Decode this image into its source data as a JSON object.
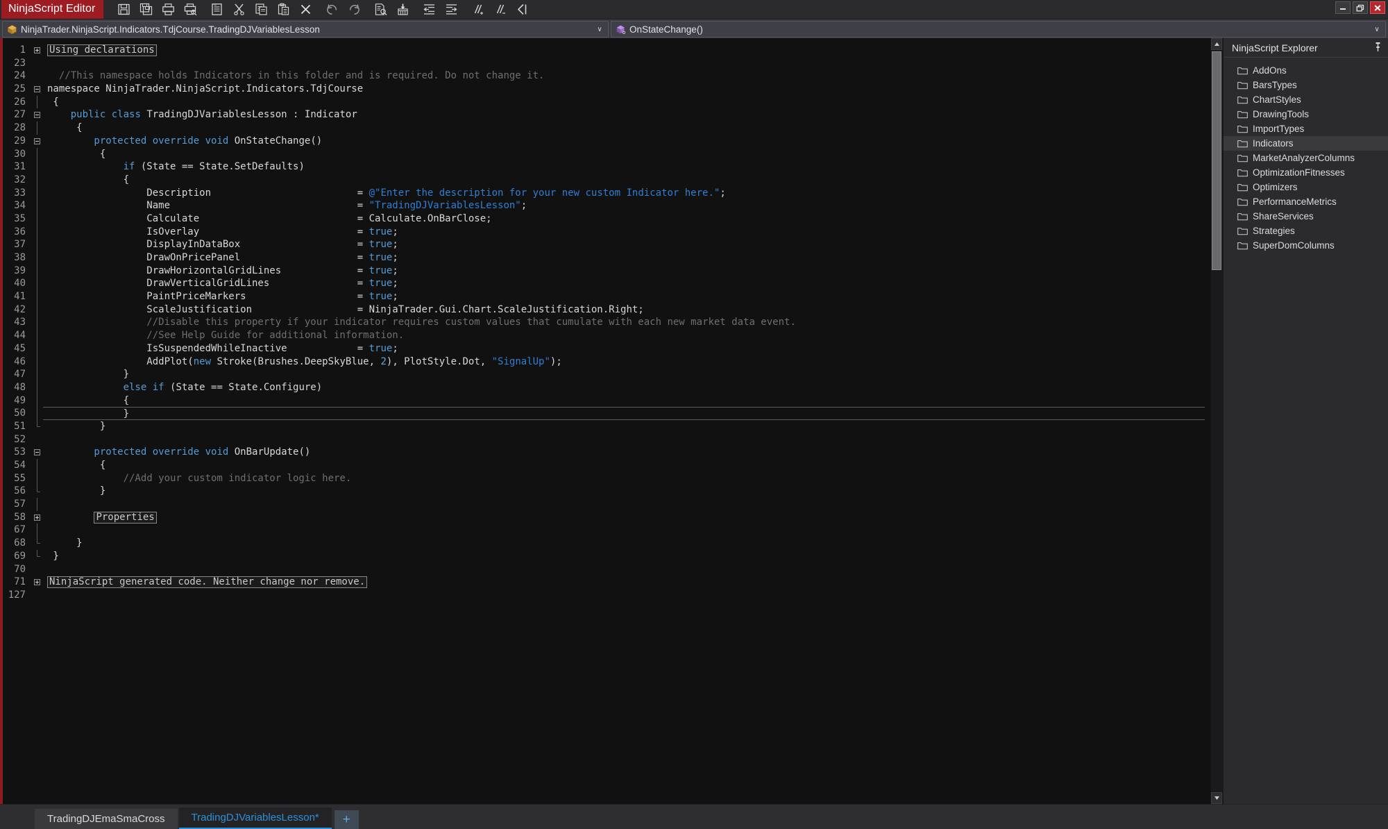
{
  "window": {
    "app_title": "NinjaScript Editor",
    "controls": {
      "minimize": "minimize-button",
      "restore": "restore-button",
      "close": "close-button"
    },
    "accent_red": "#9c1c22",
    "accent_blue": "#2f8fd6"
  },
  "toolbar": {
    "items": [
      {
        "name": "save-icon",
        "tip": "Save"
      },
      {
        "name": "save-all-icon",
        "tip": "Save All"
      },
      {
        "name": "print-icon",
        "tip": "Print"
      },
      {
        "name": "print-preview-icon",
        "tip": "Print Preview"
      },
      {
        "name": "new-file-icon",
        "tip": "New"
      },
      {
        "name": "cut-icon",
        "tip": "Cut"
      },
      {
        "name": "copy-icon",
        "tip": "Copy"
      },
      {
        "name": "paste-icon",
        "tip": "Paste"
      },
      {
        "name": "delete-icon",
        "tip": "Delete"
      },
      {
        "name": "undo-icon",
        "tip": "Undo"
      },
      {
        "name": "redo-icon",
        "tip": "Redo"
      },
      {
        "name": "find-icon",
        "tip": "Find"
      },
      {
        "name": "compile-icon",
        "tip": "Compile"
      },
      {
        "name": "outdent-icon",
        "tip": "Outdent"
      },
      {
        "name": "indent-icon",
        "tip": "Indent"
      },
      {
        "name": "comment-icon",
        "tip": "Comment"
      },
      {
        "name": "uncomment-icon",
        "tip": "Uncomment"
      },
      {
        "name": "collapse-icon",
        "tip": "Collapse"
      }
    ]
  },
  "navbar": {
    "class_selector": {
      "value": "NinjaTrader.NinjaScript.Indicators.TdjCourse.TradingDJVariablesLesson",
      "arrow": "∨"
    },
    "member_selector": {
      "value": "OnStateChange()",
      "arrow": "∨"
    }
  },
  "editor": {
    "line_numbers": [
      "1",
      "23",
      "24",
      "25",
      "26",
      "27",
      "28",
      "29",
      "30",
      "31",
      "32",
      "33",
      "34",
      "35",
      "36",
      "37",
      "38",
      "39",
      "40",
      "41",
      "42",
      "43",
      "44",
      "45",
      "46",
      "47",
      "48",
      "49",
      "50",
      "51",
      "52",
      "53",
      "54",
      "55",
      "56",
      "57",
      "58",
      "67",
      "68",
      "69",
      "70",
      "71",
      "127"
    ],
    "current_line": "50",
    "collapsed_regions": [
      {
        "line": "1",
        "label": "Using declarations"
      },
      {
        "line": "58",
        "label": "Properties"
      },
      {
        "line": "71",
        "label": "NinjaScript generated code. Neither change nor remove."
      }
    ],
    "code_lines": [
      {
        "n": "1",
        "fold": "plus",
        "segments": [
          {
            "t": "Using declarations",
            "c": "boxed"
          }
        ]
      },
      {
        "n": "23",
        "fold": "none",
        "segments": []
      },
      {
        "n": "24",
        "fold": "none",
        "segments": [
          {
            "t": "  //This namespace holds Indicators in this folder and is required. Do not change it.",
            "c": "cmt"
          }
        ]
      },
      {
        "n": "25",
        "fold": "minus",
        "segments": [
          {
            "t": "namespace NinjaTrader.NinjaScript.Indicators.TdjCourse",
            "c": "plain"
          }
        ]
      },
      {
        "n": "26",
        "fold": "bar",
        "segments": [
          {
            "t": " {",
            "c": "plain"
          }
        ]
      },
      {
        "n": "27",
        "fold": "minus",
        "segments": [
          {
            "t": "    public",
            "c": "kw"
          },
          {
            "t": " ",
            "c": "plain"
          },
          {
            "t": "class",
            "c": "kw"
          },
          {
            "t": " TradingDJVariablesLesson : Indicator",
            "c": "plain"
          }
        ]
      },
      {
        "n": "28",
        "fold": "bar",
        "segments": [
          {
            "t": "     {",
            "c": "plain"
          }
        ]
      },
      {
        "n": "29",
        "fold": "minus",
        "segments": [
          {
            "t": "        protected",
            "c": "kw"
          },
          {
            "t": " ",
            "c": "plain"
          },
          {
            "t": "override",
            "c": "kw"
          },
          {
            "t": " ",
            "c": "plain"
          },
          {
            "t": "void",
            "c": "kw"
          },
          {
            "t": " OnStateChange()",
            "c": "plain"
          }
        ]
      },
      {
        "n": "30",
        "fold": "bar",
        "segments": [
          {
            "t": "         {",
            "c": "plain"
          }
        ]
      },
      {
        "n": "31",
        "fold": "bar",
        "segments": [
          {
            "t": "             if",
            "c": "kw"
          },
          {
            "t": " (State == State.SetDefaults)",
            "c": "plain"
          }
        ]
      },
      {
        "n": "32",
        "fold": "bar",
        "segments": [
          {
            "t": "             {",
            "c": "plain"
          }
        ]
      },
      {
        "n": "33",
        "fold": "bar",
        "segments": [
          {
            "t": "                 Description                         = ",
            "c": "plain"
          },
          {
            "t": "@\"Enter the description for your new custom Indicator here.\"",
            "c": "str"
          },
          {
            "t": ";",
            "c": "plain"
          }
        ]
      },
      {
        "n": "34",
        "fold": "bar",
        "segments": [
          {
            "t": "                 Name                                = ",
            "c": "plain"
          },
          {
            "t": "\"TradingDJVariablesLesson\"",
            "c": "str"
          },
          {
            "t": ";",
            "c": "plain"
          }
        ]
      },
      {
        "n": "35",
        "fold": "bar",
        "segments": [
          {
            "t": "                 Calculate                           = Calculate.OnBarClose;",
            "c": "plain"
          }
        ]
      },
      {
        "n": "36",
        "fold": "bar",
        "segments": [
          {
            "t": "                 IsOverlay                           = ",
            "c": "plain"
          },
          {
            "t": "true",
            "c": "kw"
          },
          {
            "t": ";",
            "c": "plain"
          }
        ]
      },
      {
        "n": "37",
        "fold": "bar",
        "segments": [
          {
            "t": "                 DisplayInDataBox                    = ",
            "c": "plain"
          },
          {
            "t": "true",
            "c": "kw"
          },
          {
            "t": ";",
            "c": "plain"
          }
        ]
      },
      {
        "n": "38",
        "fold": "bar",
        "segments": [
          {
            "t": "                 DrawOnPricePanel                    = ",
            "c": "plain"
          },
          {
            "t": "true",
            "c": "kw"
          },
          {
            "t": ";",
            "c": "plain"
          }
        ]
      },
      {
        "n": "39",
        "fold": "bar",
        "segments": [
          {
            "t": "                 DrawHorizontalGridLines             = ",
            "c": "plain"
          },
          {
            "t": "true",
            "c": "kw"
          },
          {
            "t": ";",
            "c": "plain"
          }
        ]
      },
      {
        "n": "40",
        "fold": "bar",
        "segments": [
          {
            "t": "                 DrawVerticalGridLines               = ",
            "c": "plain"
          },
          {
            "t": "true",
            "c": "kw"
          },
          {
            "t": ";",
            "c": "plain"
          }
        ]
      },
      {
        "n": "41",
        "fold": "bar",
        "segments": [
          {
            "t": "                 PaintPriceMarkers                   = ",
            "c": "plain"
          },
          {
            "t": "true",
            "c": "kw"
          },
          {
            "t": ";",
            "c": "plain"
          }
        ]
      },
      {
        "n": "42",
        "fold": "bar",
        "segments": [
          {
            "t": "                 ScaleJustification                  = NinjaTrader.Gui.Chart.ScaleJustification.Right;",
            "c": "plain"
          }
        ]
      },
      {
        "n": "43",
        "fold": "bar",
        "segments": [
          {
            "t": "                 //Disable this property if your indicator requires custom values that cumulate with each new market data event.",
            "c": "cmt"
          }
        ]
      },
      {
        "n": "44",
        "fold": "bar",
        "segments": [
          {
            "t": "                 //See Help Guide for additional information.",
            "c": "cmt"
          }
        ]
      },
      {
        "n": "45",
        "fold": "bar",
        "segments": [
          {
            "t": "                 IsSuspendedWhileInactive            = ",
            "c": "plain"
          },
          {
            "t": "true",
            "c": "kw"
          },
          {
            "t": ";",
            "c": "plain"
          }
        ]
      },
      {
        "n": "46",
        "fold": "bar",
        "segments": [
          {
            "t": "                 AddPlot(",
            "c": "plain"
          },
          {
            "t": "new",
            "c": "kw"
          },
          {
            "t": " Stroke(Brushes.DeepSkyBlue, ",
            "c": "plain"
          },
          {
            "t": "2",
            "c": "num"
          },
          {
            "t": "), PlotStyle.Dot, ",
            "c": "plain"
          },
          {
            "t": "\"SignalUp\"",
            "c": "str"
          },
          {
            "t": ");",
            "c": "plain"
          }
        ]
      },
      {
        "n": "47",
        "fold": "bar",
        "segments": [
          {
            "t": "             }",
            "c": "plain"
          }
        ]
      },
      {
        "n": "48",
        "fold": "bar",
        "segments": [
          {
            "t": "             else",
            "c": "kw"
          },
          {
            "t": " ",
            "c": "plain"
          },
          {
            "t": "if",
            "c": "kw"
          },
          {
            "t": " (State == State.Configure)",
            "c": "plain"
          }
        ]
      },
      {
        "n": "49",
        "fold": "bar",
        "segments": [
          {
            "t": "             {",
            "c": "plain"
          }
        ]
      },
      {
        "n": "50",
        "fold": "bar",
        "segments": [
          {
            "t": "             }",
            "c": "plain"
          }
        ]
      },
      {
        "n": "51",
        "fold": "bar-end",
        "segments": [
          {
            "t": "         }",
            "c": "plain"
          }
        ]
      },
      {
        "n": "52",
        "fold": "none",
        "segments": []
      },
      {
        "n": "53",
        "fold": "minus",
        "segments": [
          {
            "t": "        protected",
            "c": "kw"
          },
          {
            "t": " ",
            "c": "plain"
          },
          {
            "t": "override",
            "c": "kw"
          },
          {
            "t": " ",
            "c": "plain"
          },
          {
            "t": "void",
            "c": "kw"
          },
          {
            "t": " OnBarUpdate()",
            "c": "plain"
          }
        ]
      },
      {
        "n": "54",
        "fold": "bar",
        "segments": [
          {
            "t": "         {",
            "c": "plain"
          }
        ]
      },
      {
        "n": "55",
        "fold": "bar",
        "segments": [
          {
            "t": "             //Add your custom indicator logic here.",
            "c": "cmt"
          }
        ]
      },
      {
        "n": "56",
        "fold": "bar-end",
        "segments": [
          {
            "t": "         }",
            "c": "plain"
          }
        ]
      },
      {
        "n": "57",
        "fold": "bar",
        "segments": []
      },
      {
        "n": "58",
        "fold": "plus",
        "segments": [
          {
            "t": "        ",
            "c": "plain"
          },
          {
            "t": "Properties",
            "c": "boxed"
          }
        ]
      },
      {
        "n": "67",
        "fold": "bar",
        "segments": []
      },
      {
        "n": "68",
        "fold": "bar-end",
        "segments": [
          {
            "t": "     }",
            "c": "plain"
          }
        ]
      },
      {
        "n": "69",
        "fold": "end",
        "segments": [
          {
            "t": " }",
            "c": "plain"
          }
        ]
      },
      {
        "n": "70",
        "fold": "none",
        "segments": []
      },
      {
        "n": "71",
        "fold": "plus",
        "segments": [
          {
            "t": "NinjaScript generated code. Neither change nor remove.",
            "c": "boxed"
          }
        ]
      },
      {
        "n": "127",
        "fold": "none",
        "segments": []
      }
    ],
    "scrollbar": {
      "up_arrow": "▲",
      "down_arrow": "▼"
    }
  },
  "explorer": {
    "title": "NinjaScript Explorer",
    "pin_icon": "pin-icon",
    "selected": "Indicators",
    "items": [
      {
        "label": "AddOns"
      },
      {
        "label": "BarsTypes"
      },
      {
        "label": "ChartStyles"
      },
      {
        "label": "DrawingTools"
      },
      {
        "label": "ImportTypes"
      },
      {
        "label": "Indicators"
      },
      {
        "label": "MarketAnalyzerColumns"
      },
      {
        "label": "OptimizationFitnesses"
      },
      {
        "label": "Optimizers"
      },
      {
        "label": "PerformanceMetrics"
      },
      {
        "label": "ShareServices"
      },
      {
        "label": "Strategies"
      },
      {
        "label": "SuperDomColumns"
      }
    ]
  },
  "tabs": {
    "items": [
      {
        "label": "TradingDJEmaSmaCross",
        "active": false
      },
      {
        "label": "TradingDJVariablesLesson*",
        "active": true
      }
    ],
    "add_label": "+"
  }
}
